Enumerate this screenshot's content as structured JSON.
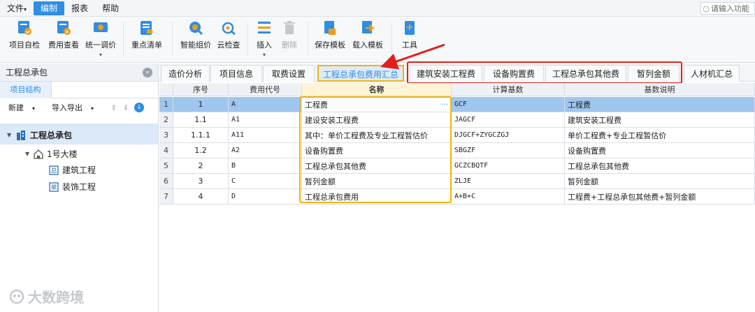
{
  "menu": {
    "items": [
      "文件",
      "编制",
      "报表",
      "帮助"
    ],
    "file_label": "文件",
    "edit_label": "编制",
    "report_label": "报表",
    "help_label": "帮助",
    "search_placeholder": "请输入功能"
  },
  "ribbon": {
    "self_check": "项目自检",
    "fee_view": "费用查看",
    "unified_price": "统一调价",
    "key_list": "重点清单",
    "smart_price": "智能组价",
    "cloud_check": "云检查",
    "insert": "插入",
    "delete": "删除",
    "save_template": "保存模板",
    "load_template": "载入模板",
    "tools": "工具"
  },
  "left_panel": {
    "title": "工程总承包",
    "tab": "项目结构",
    "new_label": "新建",
    "import_export_label": "导入导出",
    "tree": {
      "root": "工程总承包",
      "building": "1号大楼",
      "child1": "建筑工程",
      "child2": "装饰工程"
    }
  },
  "watermark": "大数跨境",
  "tabs": [
    "造价分析",
    "项目信息",
    "取费设置",
    "工程总承包费用汇总",
    "建筑安装工程费",
    "设备购置费",
    "工程总承包其他费",
    "暂列金额",
    "人材机汇总"
  ],
  "tab_labels": {
    "t0": "造价分析",
    "t1": "项目信息",
    "t2": "取费设置",
    "t3": "工程总承包费用汇总",
    "t4": "建筑安装工程费",
    "t5": "设备购置费",
    "t6": "工程总承包其他费",
    "t7": "暂列金额",
    "t8": "人材机汇总"
  },
  "grid": {
    "headers": {
      "seq": "序号",
      "code": "费用代号",
      "name": "名称",
      "base": "计算基数",
      "base_desc": "基数说明"
    },
    "rows": [
      {
        "num": "1",
        "seq": "1",
        "code": "A",
        "name": "工程费",
        "base": "GCF",
        "desc": "工程费"
      },
      {
        "num": "2",
        "seq": "1.1",
        "code": "A1",
        "name": "建设安装工程费",
        "base": "JAGCF",
        "desc": "建筑安装工程费"
      },
      {
        "num": "3",
        "seq": "1.1.1",
        "code": "A11",
        "name": "其中：单价工程费及专业工程暂估价",
        "base": "DJGCF+ZYGCZGJ",
        "desc": "单价工程费+专业工程暂估价"
      },
      {
        "num": "4",
        "seq": "1.2",
        "code": "A2",
        "name": "设备购置费",
        "base": "SBGZF",
        "desc": "设备购置费"
      },
      {
        "num": "5",
        "seq": "2",
        "code": "B",
        "name": "工程总承包其他费",
        "base": "GCZCBQTF",
        "desc": "工程总承包其他费"
      },
      {
        "num": "6",
        "seq": "3",
        "code": "C",
        "name": "暂列金额",
        "base": "ZLJE",
        "desc": "暂列金额"
      },
      {
        "num": "7",
        "seq": "4",
        "code": "D",
        "name": "工程总承包费用",
        "base": "A+B+C",
        "desc": "工程费+工程总承包其他费+暂列金额"
      }
    ]
  },
  "colors": {
    "accent": "#2f8de4",
    "highlight_red": "#e0201b",
    "highlight_yellow": "#f5b400",
    "selected_row": "#9fc6ef"
  }
}
